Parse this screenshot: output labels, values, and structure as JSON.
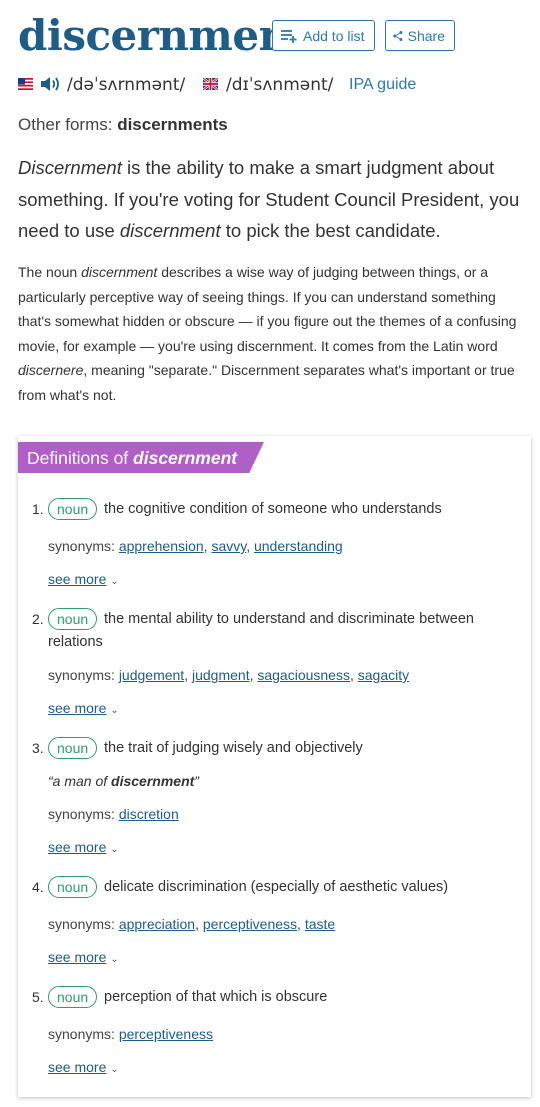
{
  "header": {
    "word": "discernment",
    "add_to_list": "Add to list",
    "share": "Share"
  },
  "pronunciation": {
    "us": "/dəˈsʌrnmənt/",
    "uk": "/dɪˈsʌnmənt/",
    "ipa_guide": "IPA guide"
  },
  "other_forms": {
    "label": "Other forms:",
    "value": "discernments"
  },
  "short_def": {
    "t1_italic": "Discernment",
    "t2": " is the ability to make a smart judgment about something. If you're voting for Student Council President, you need to use ",
    "t3_italic": "discernment",
    "t4": " to pick the best candidate."
  },
  "long_def": {
    "t1": "The noun ",
    "t2_italic": "discernment",
    "t3": " describes a wise way of judging between things, or a particularly perceptive way of seeing things. If you can understand something that's somewhat hidden or obscure — if you figure out the themes of a confusing movie, for example — you're using discernment. It comes from the Latin word ",
    "t4_italic": "discernere",
    "t5": ", meaning \"separate.\" Discernment separates what's important or true from what's not."
  },
  "definitions": {
    "title_prefix": "Definitions of ",
    "title_word": "discernment",
    "synonyms_label": "synonyms:",
    "see_more": "see more",
    "senses": [
      {
        "num": "1.",
        "pos": "noun",
        "def": "the cognitive condition of someone who understands",
        "synonyms": [
          "apprehension",
          "savvy",
          "understanding"
        ]
      },
      {
        "num": "2.",
        "pos": "noun",
        "def_line1": "the mental ability to understand and discriminate between",
        "def_line2": "relations",
        "synonyms": [
          "judgement",
          "judgment",
          "sagaciousness",
          "sagacity"
        ]
      },
      {
        "num": "3.",
        "pos": "noun",
        "def": "the trait of judging wisely and objectively",
        "example_pre": "“a man of ",
        "example_word": "discernment",
        "example_post": "”",
        "synonyms": [
          "discretion"
        ]
      },
      {
        "num": "4.",
        "pos": "noun",
        "def": "delicate discrimination (especially of aesthetic values)",
        "synonyms": [
          "appreciation",
          "perceptiveness",
          "taste"
        ]
      },
      {
        "num": "5.",
        "pos": "noun",
        "def": "perception of that which is obscure",
        "synonyms": [
          "perceptiveness"
        ]
      }
    ]
  },
  "colors": {
    "heading_blue": "#1f5c86",
    "link_blue": "#2a7ab0",
    "banner_purple": "#b05fc6",
    "pos_green": "#2f9e6b"
  },
  "icons": {
    "add": "list-add-icon",
    "share": "share-icon",
    "audio": "speaker-icon",
    "us_flag": "us-flag-icon",
    "uk_flag": "uk-flag-icon",
    "chevron": "chevron-down-icon"
  }
}
